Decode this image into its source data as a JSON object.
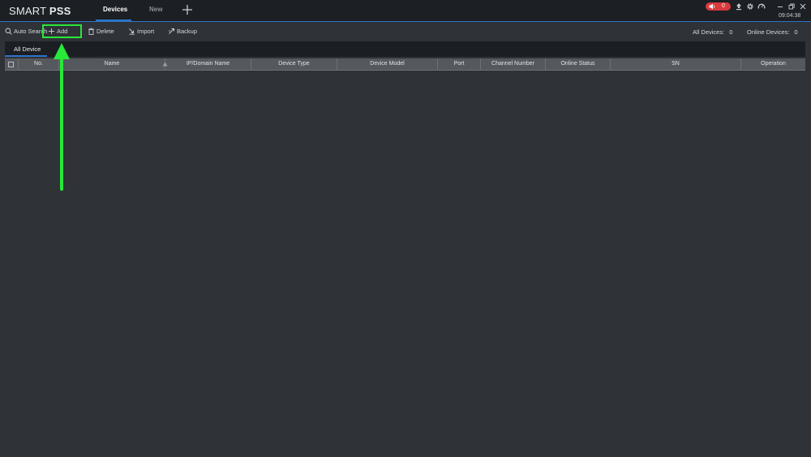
{
  "app": {
    "logo_prefix": "SMART",
    "logo_suffix": "PSS"
  },
  "titlebar": {
    "tabs": [
      {
        "label": "Devices",
        "active": true
      },
      {
        "label": "New",
        "active": false
      }
    ],
    "alarm_count": "0",
    "time": "09:04:38",
    "icons": [
      "add-tab-icon",
      "speaker-icon",
      "upload-icon",
      "gear-icon",
      "gauge-icon",
      "minimize-icon",
      "restore-icon",
      "close-icon"
    ]
  },
  "toolbar": {
    "auto_search": "Auto Search",
    "add": "Add",
    "delete": "Delete",
    "import": "Import",
    "backup": "Backup",
    "all_devices_label": "All Devices:",
    "all_devices_value": "0",
    "online_devices_label": "Online Devices:",
    "online_devices_value": "0"
  },
  "groups": {
    "active_tab": "All Device"
  },
  "table": {
    "columns": [
      "No.",
      "Name",
      "IP/Domain Name",
      "Device Type",
      "Device Model",
      "Port",
      "Channel Number",
      "Online Status",
      "SN",
      "Operation"
    ],
    "rows": []
  },
  "colors": {
    "accent": "#2d74c7",
    "alarm": "#d8393d",
    "highlight": "#28e83a",
    "background": "#2f3236",
    "titlebar": "#1c1f23",
    "header": "#55595e"
  }
}
